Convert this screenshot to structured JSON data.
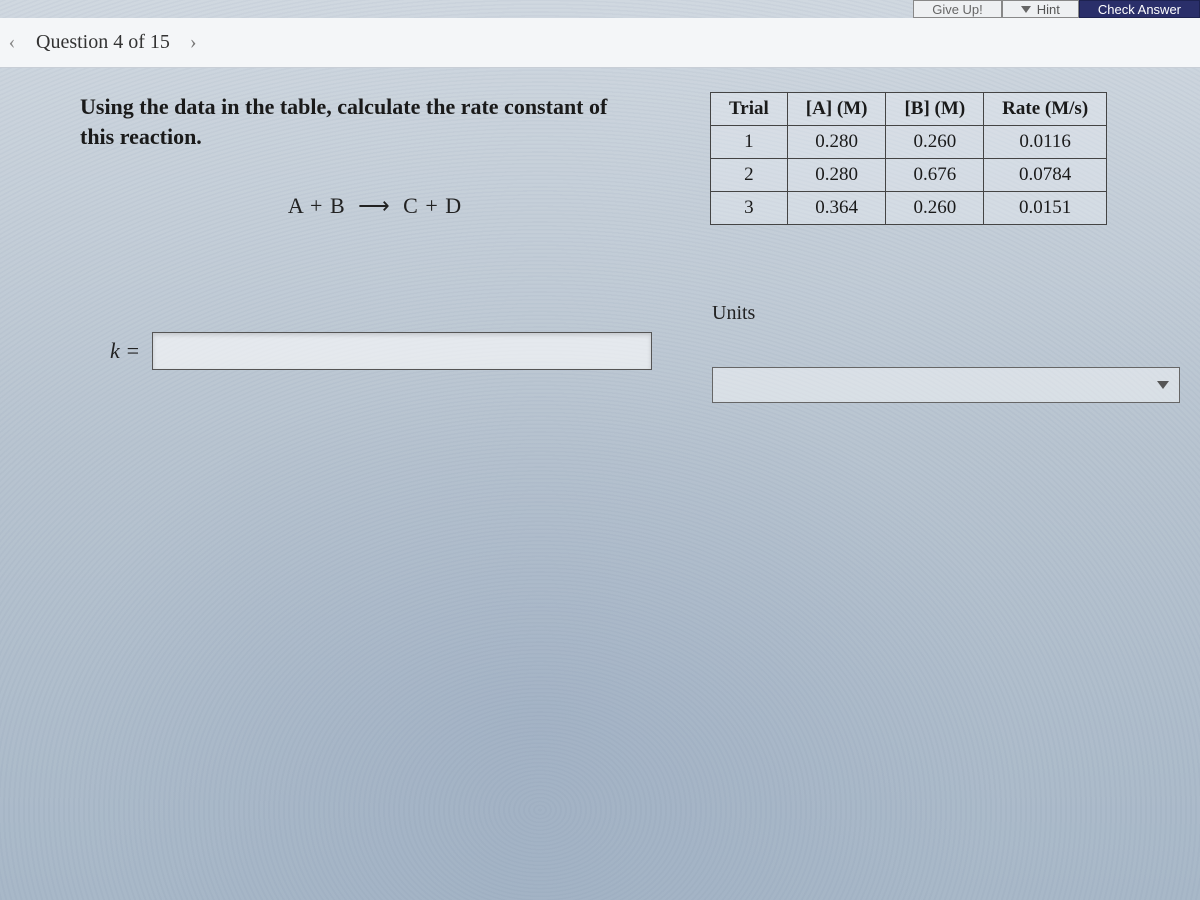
{
  "topbar": {
    "give_up_label": "Give Up!",
    "hint_label": "Hint",
    "check_answer_label": "Check Answer"
  },
  "question_bar": {
    "label": "Question 4 of 15",
    "prev_glyph": "‹",
    "next_glyph": "›"
  },
  "prompt": {
    "line1": "Using the data in the table, calculate the rate constant of",
    "line2": "this reaction.",
    "reaction_left": "A + B",
    "reaction_arrow": "⟶",
    "reaction_right": "C + D"
  },
  "table": {
    "headers": [
      "Trial",
      "[A] (M)",
      "[B] (M)",
      "Rate (M/s)"
    ],
    "rows": [
      [
        "1",
        "0.280",
        "0.260",
        "0.0116"
      ],
      [
        "2",
        "0.280",
        "0.676",
        "0.0784"
      ],
      [
        "3",
        "0.364",
        "0.260",
        "0.0151"
      ]
    ]
  },
  "answer": {
    "k_label": "k =",
    "units_label": "Units",
    "input_value": "",
    "units_value": ""
  }
}
